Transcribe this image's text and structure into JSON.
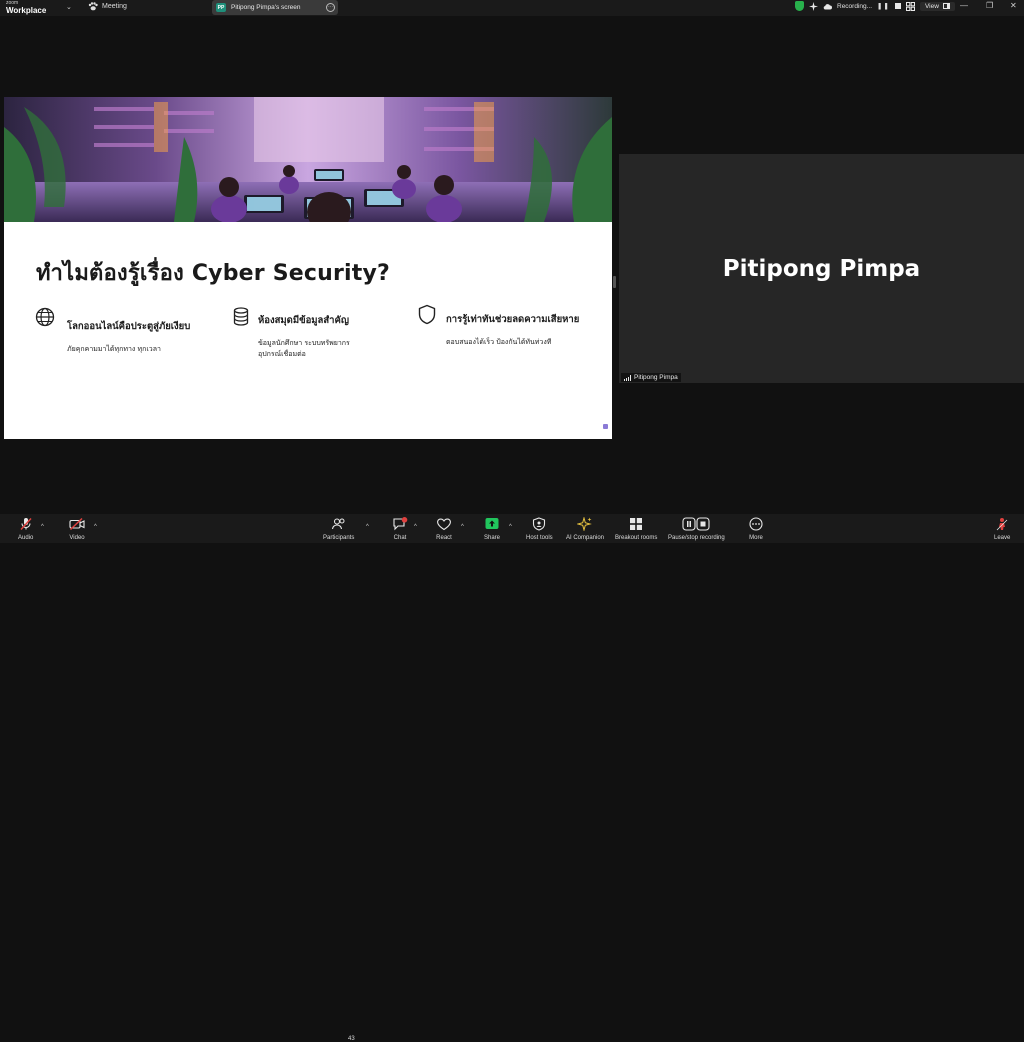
{
  "app": {
    "brand_small": "zoom",
    "brand_big": "Workplace",
    "meeting_label": "Meeting",
    "screen_tab_avatar": "PP",
    "screen_tab_label": "Pitipong Pimpa's screen",
    "recording_label": "Recording...",
    "view_label": "View"
  },
  "colors": {
    "background": "#111111",
    "topbar": "#1a1a1a",
    "recording_shield": "#28b14c",
    "avatar": "#1f8f7a",
    "share_green": "#21c55d",
    "mute_red": "#e0413f"
  },
  "slide": {
    "title": "ทำไมต้องรู้เรื่อง Cyber Security?",
    "features": [
      {
        "icon": "globe-icon",
        "title": "โลกออนไลน์คือประตูสู่ภัยเงียบ",
        "desc": [
          "ภัยคุกคามมาได้ทุกทาง ทุกเวลา"
        ]
      },
      {
        "icon": "database-icon",
        "title": "ห้องสมุดมีข้อมูลสำคัญ",
        "desc": [
          "ข้อมูลนักศึกษา ระบบทรัพยากร",
          "อุปกรณ์เชื่อมต่อ"
        ]
      },
      {
        "icon": "shield-icon",
        "title": "การรู้เท่าทันช่วยลดความเสียหาย",
        "desc": [
          "ตอบสนองได้เร็ว ป้องกันได้ทันท่วงที"
        ]
      }
    ]
  },
  "video": {
    "name": "Pitipong Pimpa",
    "label": "Pitipong Pimpa"
  },
  "toolbar": {
    "audio": "Audio",
    "video": "Video",
    "participants": "Participants",
    "participants_count": "43",
    "chat": "Chat",
    "react": "React",
    "share": "Share",
    "host_tools": "Host tools",
    "ai_companion": "AI Companion",
    "breakout_rooms": "Breakout rooms",
    "pause_recording": "Pause/stop recording",
    "more": "More",
    "leave": "Leave"
  }
}
